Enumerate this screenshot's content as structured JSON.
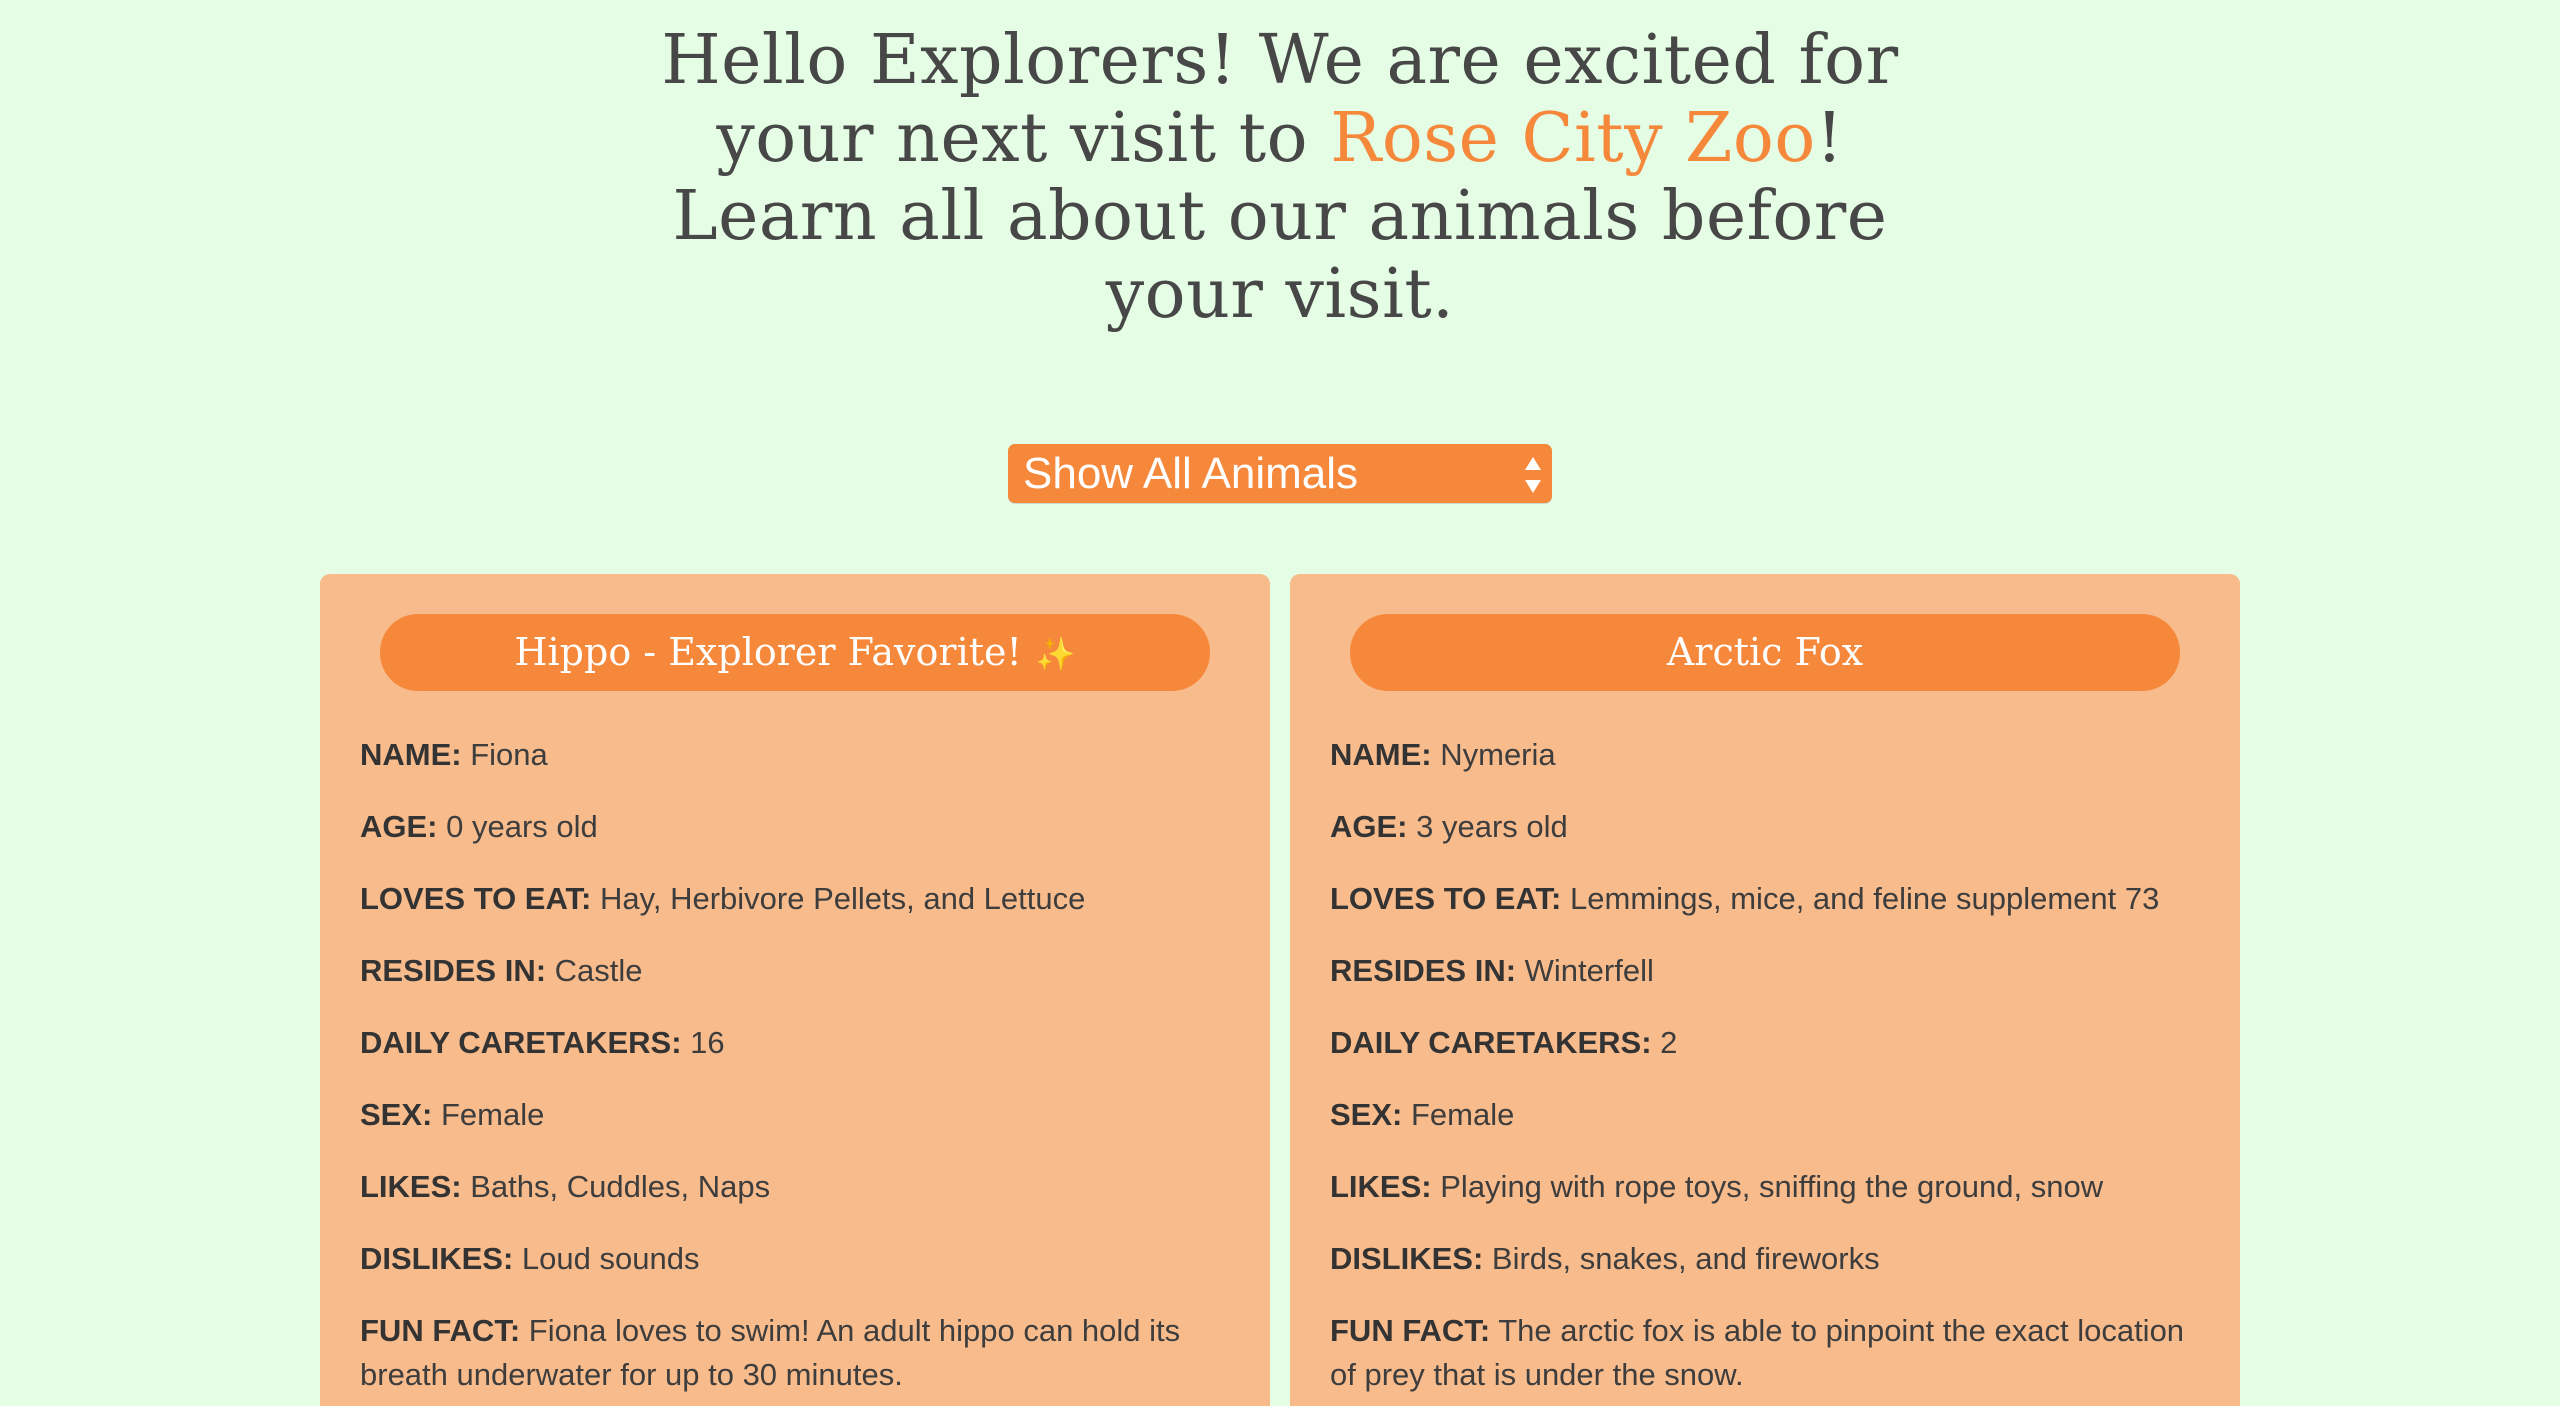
{
  "hero": {
    "line1": "Hello Explorers! We are excited for",
    "line2_before": "your next visit to ",
    "line2_zoo": "Rose City Zoo",
    "line2_after": "!",
    "line3": "Learn all about our animals before",
    "line4": "your visit."
  },
  "filter": {
    "selected": "Show All Animals"
  },
  "cards": [
    {
      "title": "Hippo - Explorer Favorite!",
      "badge_icon": "sparkle-icon",
      "fields": [
        {
          "label": "NAME:",
          "value": "Fiona"
        },
        {
          "label": "AGE:",
          "value": "0 years old"
        },
        {
          "label": "LOVES TO EAT:",
          "value": "Hay, Herbivore Pellets, and Lettuce"
        },
        {
          "label": "RESIDES IN:",
          "value": "Castle"
        },
        {
          "label": "DAILY CARETAKERS:",
          "value": "16"
        },
        {
          "label": "SEX:",
          "value": "Female"
        },
        {
          "label": "LIKES:",
          "value": "Baths, Cuddles, Naps"
        },
        {
          "label": "DISLIKES:",
          "value": "Loud sounds"
        },
        {
          "label": "FUN FACT:",
          "value": "Fiona loves to swim! An adult hippo can hold its breath underwater for up to 30 minutes."
        }
      ]
    },
    {
      "title": "Arctic Fox",
      "fields": [
        {
          "label": "NAME:",
          "value": "Nymeria"
        },
        {
          "label": "AGE:",
          "value": "3 years old"
        },
        {
          "label": "LOVES TO EAT:",
          "value": "Lemmings, mice, and feline supplement 73"
        },
        {
          "label": "RESIDES IN:",
          "value": "Winterfell"
        },
        {
          "label": "DAILY CARETAKERS:",
          "value": "2"
        },
        {
          "label": "SEX:",
          "value": "Female"
        },
        {
          "label": "LIKES:",
          "value": "Playing with rope toys, sniffing the ground, snow"
        },
        {
          "label": "DISLIKES:",
          "value": "Birds, snakes, and fireworks"
        },
        {
          "label": "FUN FACT:",
          "value": "The arctic fox is able to pinpoint the exact location of prey that is under the snow."
        }
      ]
    }
  ],
  "colors": {
    "background": "#e4fde4",
    "accent": "#f5883a",
    "card": "#f8bb8c",
    "text": "#474747"
  }
}
